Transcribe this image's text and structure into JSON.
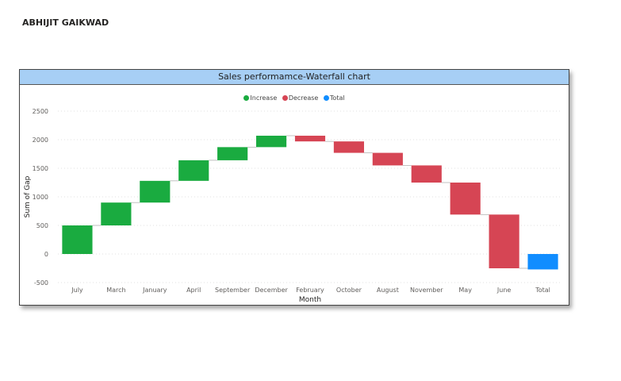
{
  "page": {
    "author": "ABHIJIT GAIKWAD"
  },
  "chart_data": {
    "type": "waterfall",
    "title": "Sales performamce-Waterfall chart",
    "xlabel": "Month",
    "ylabel": "Sum of Gap",
    "ylim": [
      -500,
      2500
    ],
    "yticks": [
      -500,
      0,
      500,
      1000,
      1500,
      2000,
      2500
    ],
    "grid": true,
    "legend_position": "top-center",
    "legend": [
      {
        "label": "Increase",
        "color": "#1aab40"
      },
      {
        "label": "Decrease",
        "color": "#d64554"
      },
      {
        "label": "Total",
        "color": "#118dff"
      }
    ],
    "categories": [
      "July",
      "March",
      "January",
      "April",
      "September",
      "December",
      "February",
      "October",
      "August",
      "November",
      "May",
      "June",
      "Total"
    ],
    "values": [
      500,
      400,
      380,
      360,
      230,
      200,
      -100,
      -200,
      -220,
      -300,
      -560,
      -940,
      -270
    ],
    "is_total": [
      false,
      false,
      false,
      false,
      false,
      false,
      false,
      false,
      false,
      false,
      false,
      false,
      true
    ]
  }
}
